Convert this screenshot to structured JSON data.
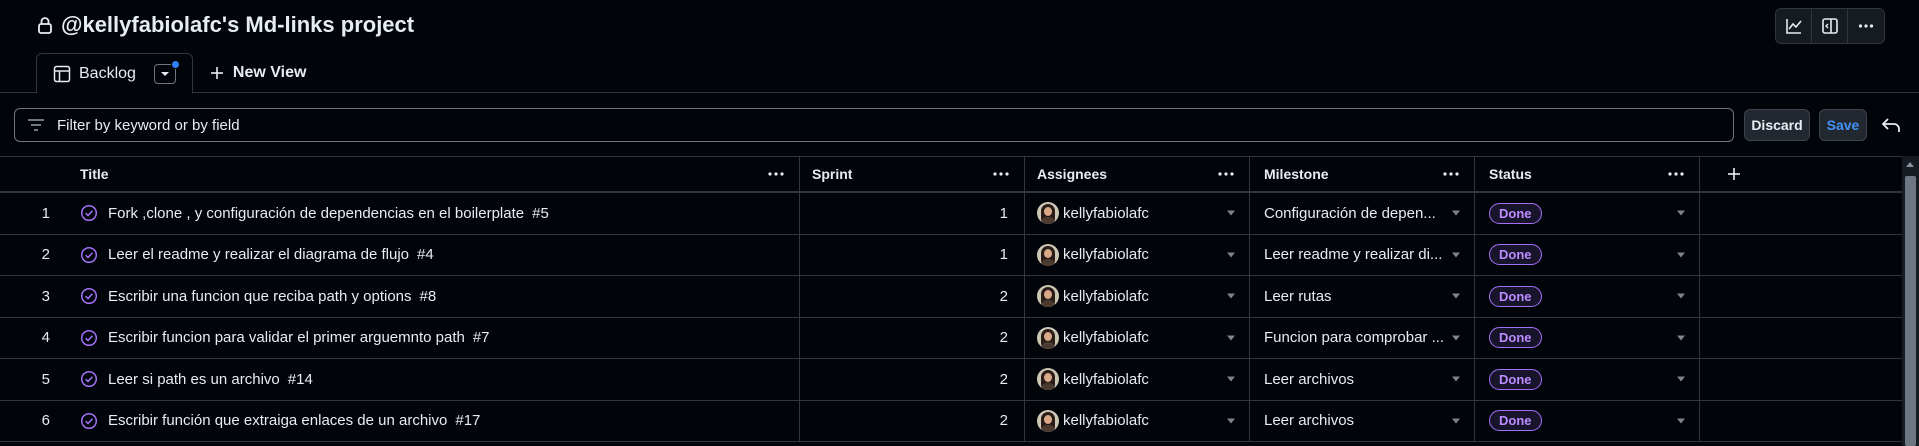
{
  "header": {
    "title": "@kellyfabiolafc's Md-links project",
    "icons": [
      "lock-icon",
      "insights-icon",
      "sidebar-icon",
      "kebab-icon"
    ]
  },
  "tabs": [
    {
      "label": "Backlog",
      "icon": "table-icon",
      "active": true
    },
    {
      "label": "New View",
      "icon": "plus-icon",
      "active": false
    }
  ],
  "filter": {
    "placeholder": "Filter by keyword or by field"
  },
  "actions": {
    "discard": "Discard",
    "save": "Save"
  },
  "columns": [
    "Title",
    "Sprint",
    "Assignees",
    "Milestone",
    "Status"
  ],
  "rows": [
    {
      "num": "1",
      "title": "Fork ,clone , y configuración de dependencias en el boilerplate",
      "issue": "#5",
      "sprint": "1",
      "assignee": "kellyfabiolafc",
      "milestone": "Configuración de depen...",
      "status": "Done"
    },
    {
      "num": "2",
      "title": "Leer el readme y realizar el diagrama de flujo",
      "issue": "#4",
      "sprint": "1",
      "assignee": "kellyfabiolafc",
      "milestone": "Leer readme y realizar di...",
      "status": "Done"
    },
    {
      "num": "3",
      "title": "Escribir una funcion que reciba path y options",
      "issue": "#8",
      "sprint": "2",
      "assignee": "kellyfabiolafc",
      "milestone": "Leer rutas",
      "status": "Done"
    },
    {
      "num": "4",
      "title": "Escribir funcion para validar el primer arguemnto path",
      "issue": "#7",
      "sprint": "2",
      "assignee": "kellyfabiolafc",
      "milestone": "Funcion para comprobar ...",
      "status": "Done"
    },
    {
      "num": "5",
      "title": "Leer si path es un archivo",
      "issue": "#14",
      "sprint": "2",
      "assignee": "kellyfabiolafc",
      "milestone": "Leer archivos",
      "status": "Done"
    },
    {
      "num": "6",
      "title": "Escribir función que extraiga enlaces de un archivo",
      "issue": "#17",
      "sprint": "2",
      "assignee": "kellyfabiolafc",
      "milestone": "Leer archivos",
      "status": "Done"
    }
  ],
  "colors": {
    "background": "#010409",
    "border": "#30363d",
    "done_badge": "#a371f7",
    "accent_blue": "#4493f8"
  }
}
